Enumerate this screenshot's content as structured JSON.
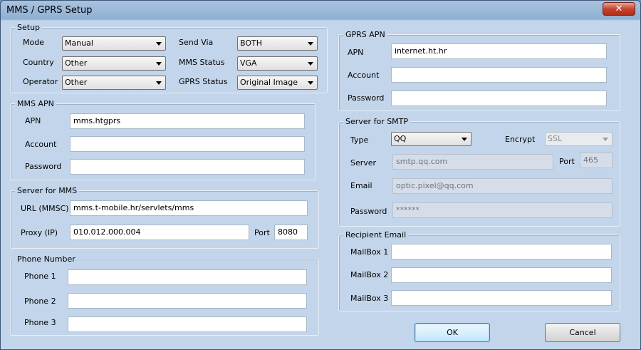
{
  "window": {
    "title": "MMS / GPRS Setup",
    "close_glyph": "✕"
  },
  "setup": {
    "legend": "Setup",
    "mode": {
      "label": "Mode",
      "value": "Manual"
    },
    "country": {
      "label": "Country",
      "value": "Other"
    },
    "operator": {
      "label": "Operator",
      "value": "Other"
    },
    "send_via": {
      "label": "Send Via",
      "value": "BOTH"
    },
    "mms_status": {
      "label": "MMS Status",
      "value": "VGA"
    },
    "gprs_status": {
      "label": "GPRS Status",
      "value": "Original Image"
    }
  },
  "mms_apn": {
    "legend": "MMS APN",
    "apn": {
      "label": "APN",
      "value": "mms.htgprs"
    },
    "account": {
      "label": "Account",
      "value": ""
    },
    "password": {
      "label": "Password",
      "value": ""
    }
  },
  "server_mms": {
    "legend": "Server for MMS",
    "url": {
      "label": "URL (MMSC)",
      "value": "mms.t-mobile.hr/servlets/mms"
    },
    "proxy": {
      "label": "Proxy (IP)",
      "value": "010.012.000.004"
    },
    "port": {
      "label": "Port",
      "value": "8080"
    }
  },
  "phone": {
    "legend": "Phone Number",
    "phone1": {
      "label": "Phone 1",
      "value": ""
    },
    "phone2": {
      "label": "Phone 2",
      "value": ""
    },
    "phone3": {
      "label": "Phone 3",
      "value": ""
    }
  },
  "gprs_apn": {
    "legend": "GPRS APN",
    "apn": {
      "label": "APN",
      "value": "internet.ht.hr"
    },
    "account": {
      "label": "Account",
      "value": ""
    },
    "password": {
      "label": "Password",
      "value": ""
    }
  },
  "smtp": {
    "legend": "Server for SMTP",
    "type": {
      "label": "Type",
      "value": "QQ"
    },
    "encrypt": {
      "label": "Encrypt",
      "value": "SSL"
    },
    "server": {
      "label": "Server",
      "value": "smtp.qq.com"
    },
    "port": {
      "label": "Port",
      "value": "465"
    },
    "email": {
      "label": "Email",
      "value": "optic.pixel@qq.com"
    },
    "password": {
      "label": "Password",
      "value": "******"
    }
  },
  "recipient": {
    "legend": "Recipient Email",
    "mailbox1": {
      "label": "MailBox 1",
      "value": ""
    },
    "mailbox2": {
      "label": "MailBox 2",
      "value": ""
    },
    "mailbox3": {
      "label": "MailBox 3",
      "value": ""
    }
  },
  "buttons": {
    "ok": "OK",
    "cancel": "Cancel"
  },
  "colors": {
    "window_bg": "#c3d5ea",
    "close_button": "#c7432f",
    "default_button": "#3c7fb1"
  }
}
